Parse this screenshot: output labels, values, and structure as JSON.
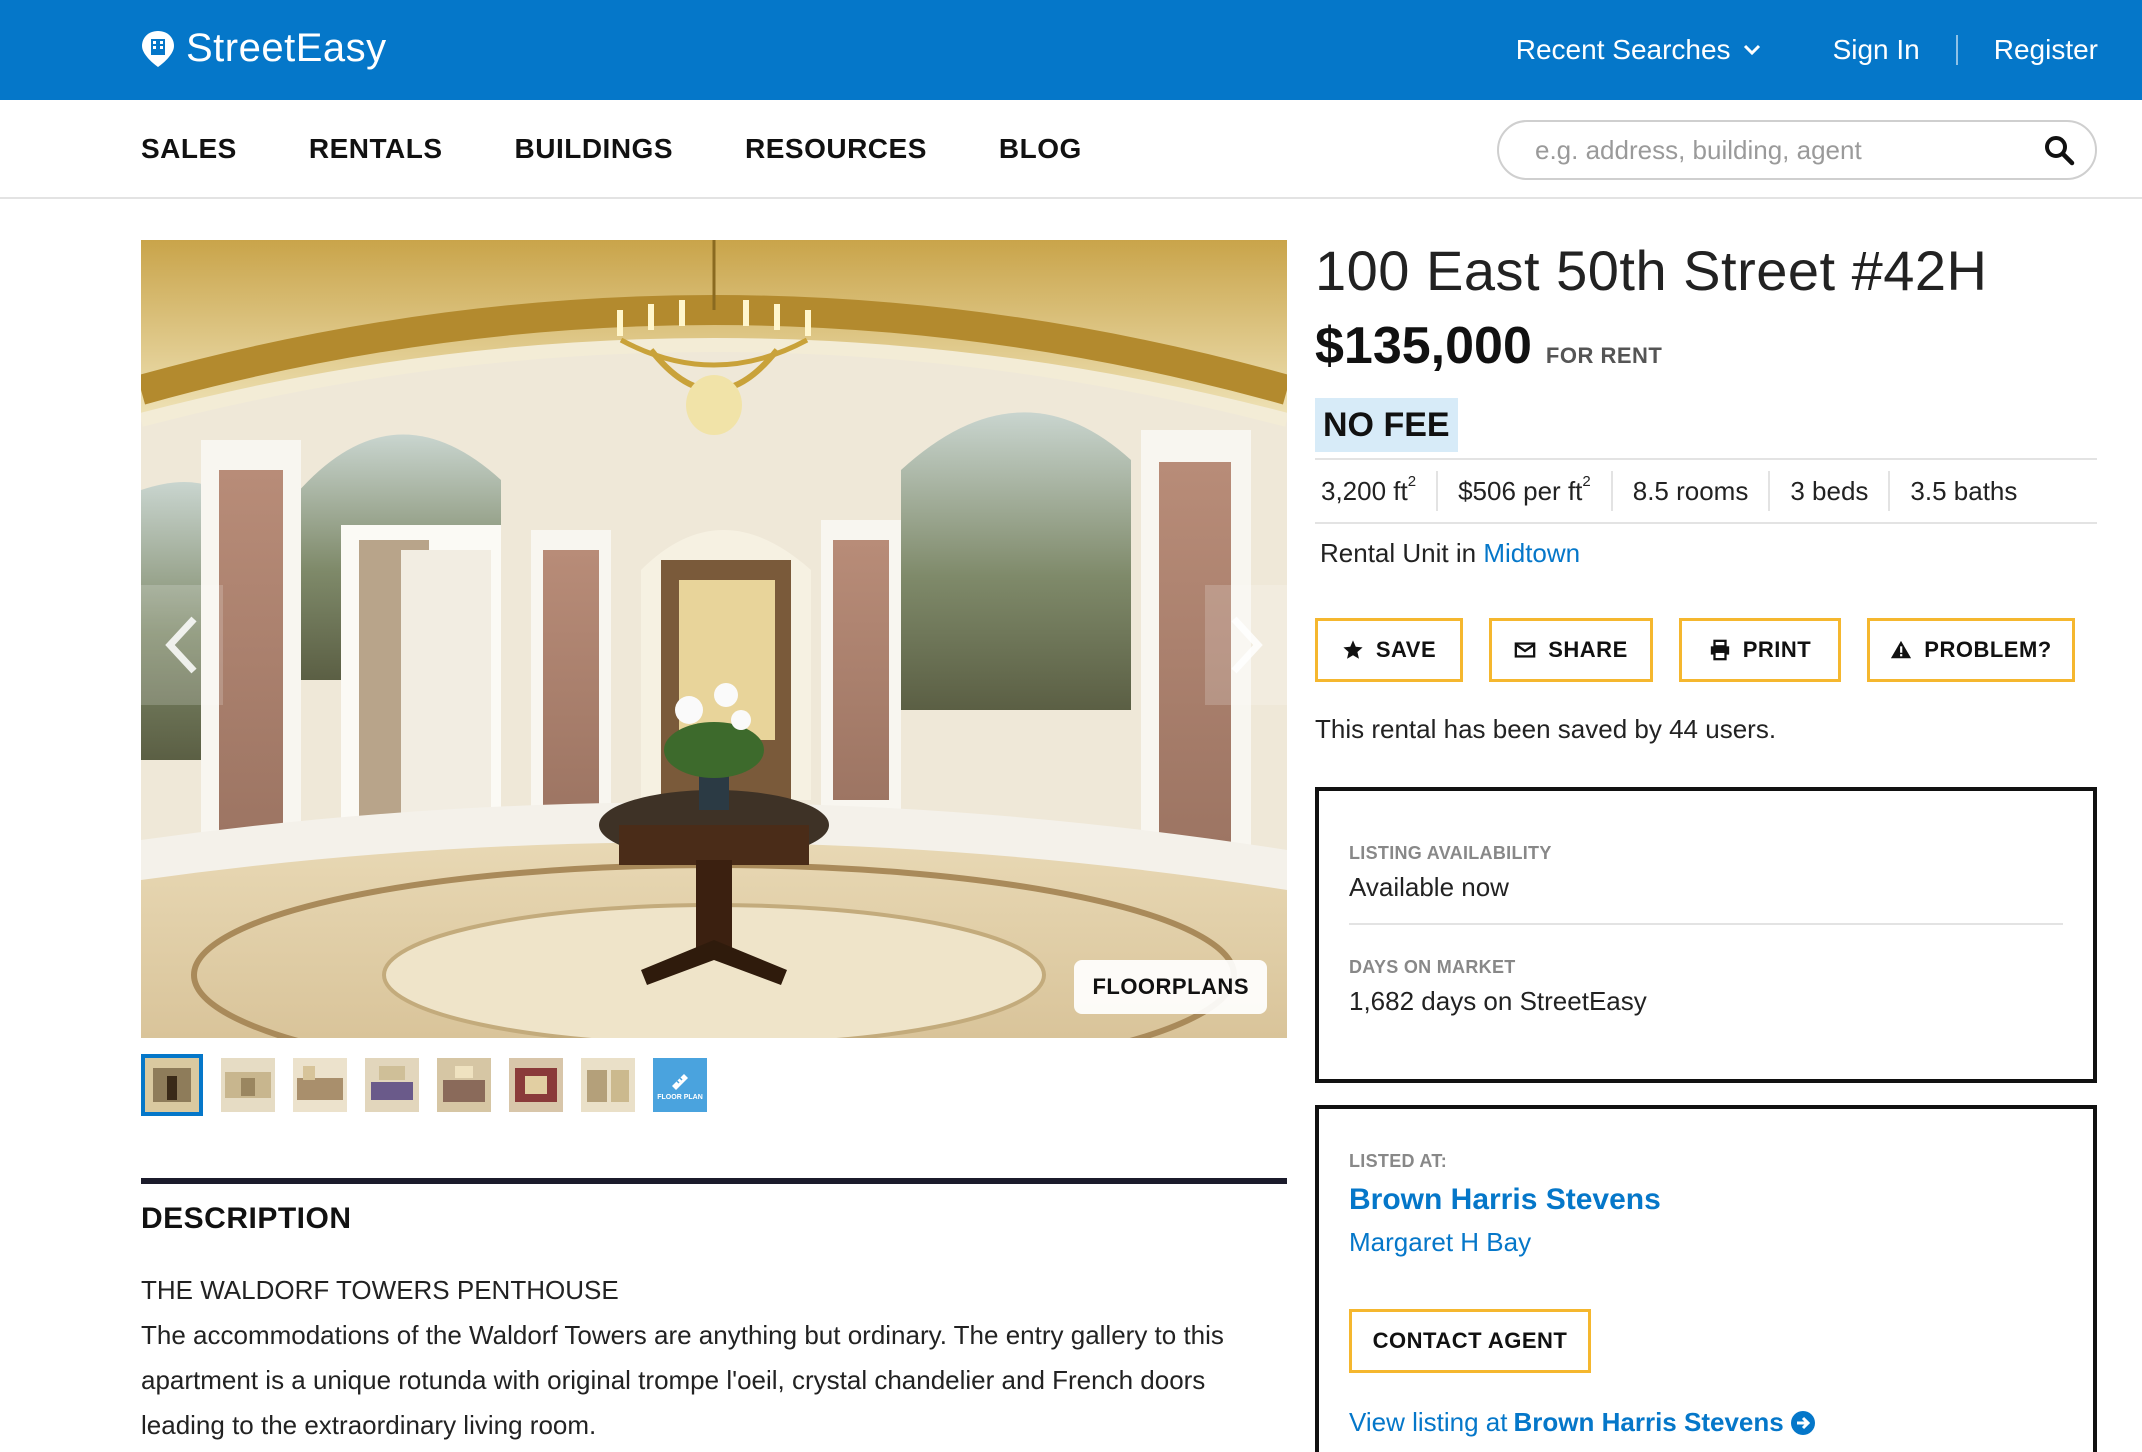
{
  "header": {
    "brand": "StreetEasy",
    "recent_searches": "Recent Searches",
    "sign_in": "Sign In",
    "register": "Register"
  },
  "nav": {
    "items": [
      "SALES",
      "RENTALS",
      "BUILDINGS",
      "RESOURCES",
      "BLOG"
    ],
    "search_placeholder": "e.g. address, building, agent"
  },
  "gallery": {
    "floorplans_label": "FLOORPLANS",
    "thumbnails_count": 8,
    "floorplan_thumb_label": "FLOOR PLAN"
  },
  "listing": {
    "address": "100 East 50th Street #42H",
    "price": "$135,000",
    "status": "FOR RENT",
    "fee_badge": "NO FEE",
    "stats": {
      "size_value": "3,200 ft",
      "size_sup": "2",
      "ppsf_value": "$506 per ft",
      "ppsf_sup": "2",
      "rooms": "8.5 rooms",
      "beds": "3 beds",
      "baths": "3.5 baths"
    },
    "unit_type_prefix": "Rental Unit in",
    "neighborhood": "Midtown",
    "saved_text": "This rental has been saved by 44 users."
  },
  "actions": {
    "save": "SAVE",
    "share": "SHARE",
    "print": "PRINT",
    "problem": "PROBLEM?"
  },
  "availability": {
    "availability_label": "LISTING AVAILABILITY",
    "availability_value": "Available now",
    "dom_label": "DAYS ON MARKET",
    "dom_value": "1,682 days on StreetEasy"
  },
  "agent_box": {
    "listed_at_label": "LISTED AT:",
    "broker": "Brown Harris Stevens",
    "agent_name": "Margaret H Bay",
    "contact_label": "CONTACT AGENT",
    "view_prefix": "View listing at",
    "view_broker": "Brown Harris Stevens"
  },
  "description": {
    "heading": "DESCRIPTION",
    "line1": "THE WALDORF TOWERS PENTHOUSE",
    "line2": "The accommodations of the Waldorf Towers are anything but ordinary. The entry gallery to this apartment is a unique rotunda with original trompe l'oeil, crystal chandelier and French doors leading to the extraordinary living room."
  },
  "colors": {
    "brand_blue": "#0577c9",
    "accent_yellow": "#f5b72e",
    "no_fee_bg": "#d7ebf8"
  }
}
